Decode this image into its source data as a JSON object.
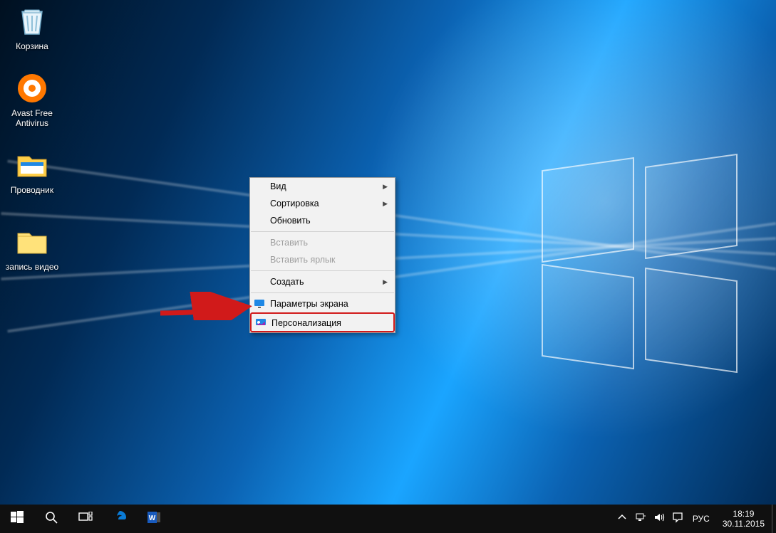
{
  "desktop_icons": [
    {
      "id": "recycle-bin",
      "label": "Корзина"
    },
    {
      "id": "avast",
      "label": "Avast Free Antivirus"
    },
    {
      "id": "explorer",
      "label": "Проводник"
    },
    {
      "id": "video-rec",
      "label": "запись видео"
    }
  ],
  "context_menu": {
    "view": "Вид",
    "sort": "Сортировка",
    "refresh": "Обновить",
    "paste": "Вставить",
    "paste_shortcut": "Вставить ярлык",
    "new": "Создать",
    "display_settings": "Параметры экрана",
    "personalize": "Персонализация"
  },
  "taskbar": {
    "start_tooltip": "Пуск",
    "search_tooltip": "Поиск",
    "taskview_tooltip": "Представление задач",
    "edge_tooltip": "Microsoft Edge",
    "word_tooltip": "Microsoft Word"
  },
  "tray": {
    "chevron_tooltip": "Показать скрытые значки",
    "network_tooltip": "Сеть",
    "sound_tooltip": "Динамики",
    "notifications_tooltip": "Уведомления",
    "language": "РУС",
    "time": "18:19",
    "date": "30.11.2015"
  }
}
